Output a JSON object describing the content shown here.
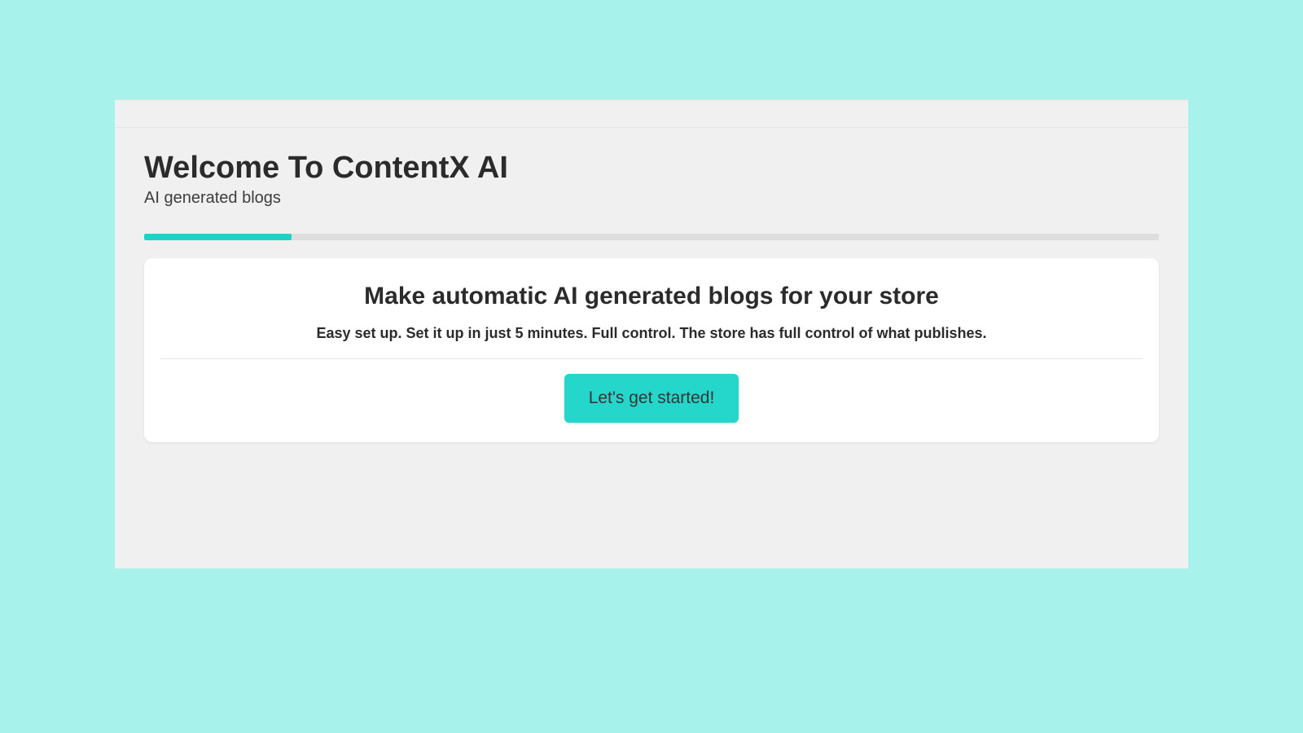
{
  "header": {
    "title": "Welcome To ContentX AI",
    "subtitle": "AI generated blogs"
  },
  "progress": {
    "percent": 14.5
  },
  "card": {
    "title": "Make automatic AI generated blogs for your store",
    "subtitle": "Easy set up. Set it up in just 5 minutes. Full control. The store has full control of what publishes.",
    "cta_label": "Let's get started!"
  },
  "colors": {
    "accent": "#1ed2c6",
    "background": "#a7f3ec",
    "panel": "#f0f0f0"
  }
}
